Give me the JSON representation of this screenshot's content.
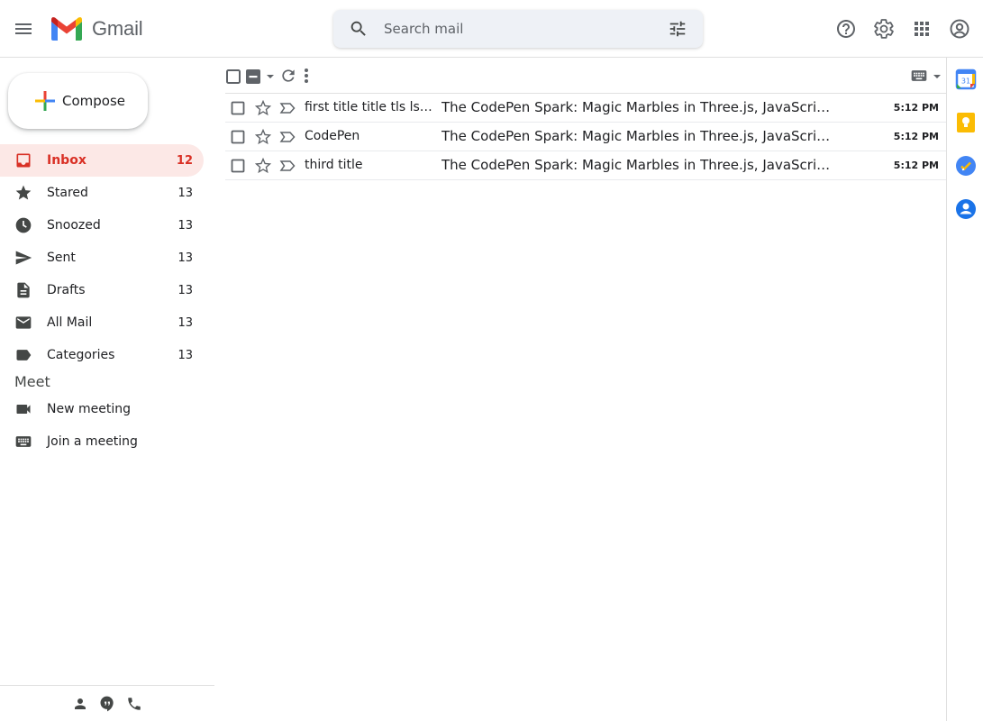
{
  "header": {
    "app_name": "Gmail",
    "search_placeholder": "Search mail"
  },
  "compose": {
    "label": "Compose"
  },
  "nav": [
    {
      "label": "Inbox",
      "count": "12",
      "icon": "inbox-icon",
      "active": true
    },
    {
      "label": "Stared",
      "count": "13",
      "icon": "star-icon"
    },
    {
      "label": "Snoozed",
      "count": "13",
      "icon": "clock-icon"
    },
    {
      "label": "Sent",
      "count": "13",
      "icon": "send-icon"
    },
    {
      "label": "Drafts",
      "count": "13",
      "icon": "draft-icon"
    },
    {
      "label": "All Mail",
      "count": "13",
      "icon": "mail-icon"
    },
    {
      "label": "Categories",
      "count": "13",
      "icon": "label-icon"
    }
  ],
  "meet": {
    "title": "Meet",
    "items": [
      {
        "label": "New meeting",
        "icon": "videocam-icon"
      },
      {
        "label": "Join a meeting",
        "icon": "keyboard-icon"
      }
    ]
  },
  "emails": [
    {
      "sender": "first title title tls lsls tlkdsjf",
      "subject": "The CodePen Spark: Magic Marbles in Three.js, JavaScript Performance Tips",
      "time": "5:12 PM"
    },
    {
      "sender": "CodePen",
      "subject": "The CodePen Spark: Magic Marbles in Three.js, JavaScript Performance Tips",
      "time": "5:12 PM"
    },
    {
      "sender": "third title",
      "subject": "The CodePen Spark: Magic Marbles in Three.js, JavaScript Performance Tips",
      "time": "5:12 PM"
    }
  ],
  "colors": {
    "accent_red": "#d93025",
    "active_bg": "#fce8e6",
    "search_bg": "#eef1f6"
  }
}
